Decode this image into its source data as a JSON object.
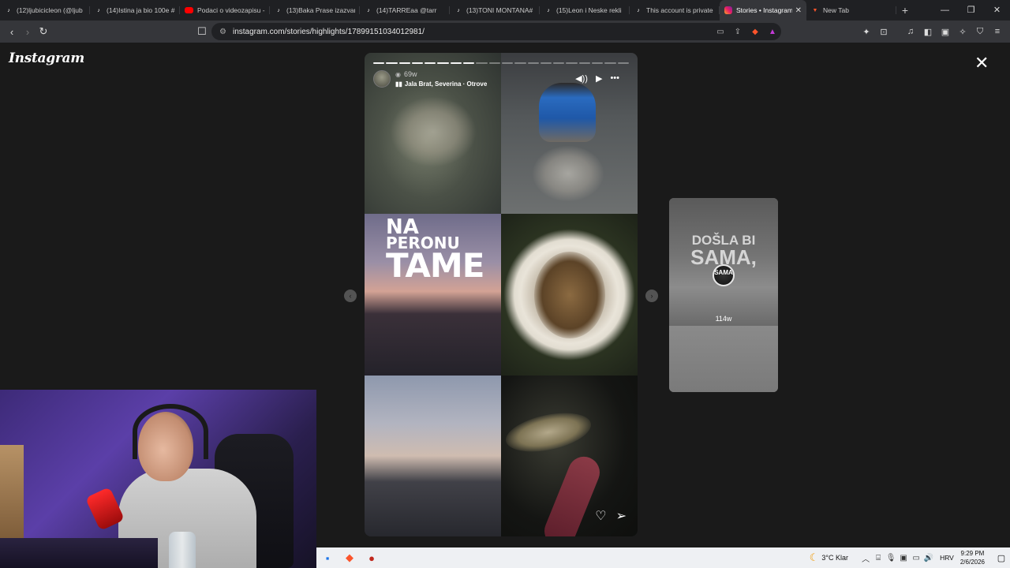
{
  "browser": {
    "tabs": [
      {
        "label": "(12)ljubicicleon (@ljub",
        "icon": "tiktok-icon",
        "active": false
      },
      {
        "label": "(14)Istina ja bio 100e #",
        "icon": "tiktok-icon",
        "active": false
      },
      {
        "label": "Podaci o videozapisu -",
        "icon": "youtube-icon",
        "active": false
      },
      {
        "label": "(13)Baka Prase izazvan",
        "icon": "tiktok-icon",
        "active": false
      },
      {
        "label": "(14)TARREaa @tarr",
        "icon": "tiktok-icon",
        "active": false
      },
      {
        "label": "(13)TONI MONTANA#",
        "icon": "tiktok-icon",
        "active": false
      },
      {
        "label": "(15)Leon i Neske rekli",
        "icon": "tiktok-icon",
        "active": false
      },
      {
        "label": "This account is private",
        "icon": "tiktok-icon",
        "active": false
      },
      {
        "label": "Stories • Instagram",
        "icon": "instagram-icon",
        "active": true
      },
      {
        "label": "New Tab",
        "icon": "brave-icon",
        "active": false
      }
    ],
    "new_tab_symbol": "+",
    "window_buttons": {
      "minimize": "—",
      "maximize": "❐",
      "close": "✕"
    },
    "url": "instagram.com/stories/highlights/17899151034012981/"
  },
  "instagram": {
    "logo": "Instagram",
    "close_symbol": "✕",
    "story": {
      "segments_total": 20,
      "segments_done": 8,
      "time_ago": "69w",
      "location": "Jala Brat, Severina · Otrove",
      "overlay_line1": "NA",
      "overlay_line2": "PERONU",
      "overlay_line3": "TAME"
    },
    "next_story": {
      "text_line1": "DOŠLA BI",
      "text_line2": "SAMA,",
      "username": "SAMA",
      "time_ago": "114w"
    }
  },
  "taskbar": {
    "weather_temp": "3°C",
    "weather_label": "Klar",
    "language": "HRV",
    "time": "9:29 PM",
    "date": "2/6/2026"
  }
}
